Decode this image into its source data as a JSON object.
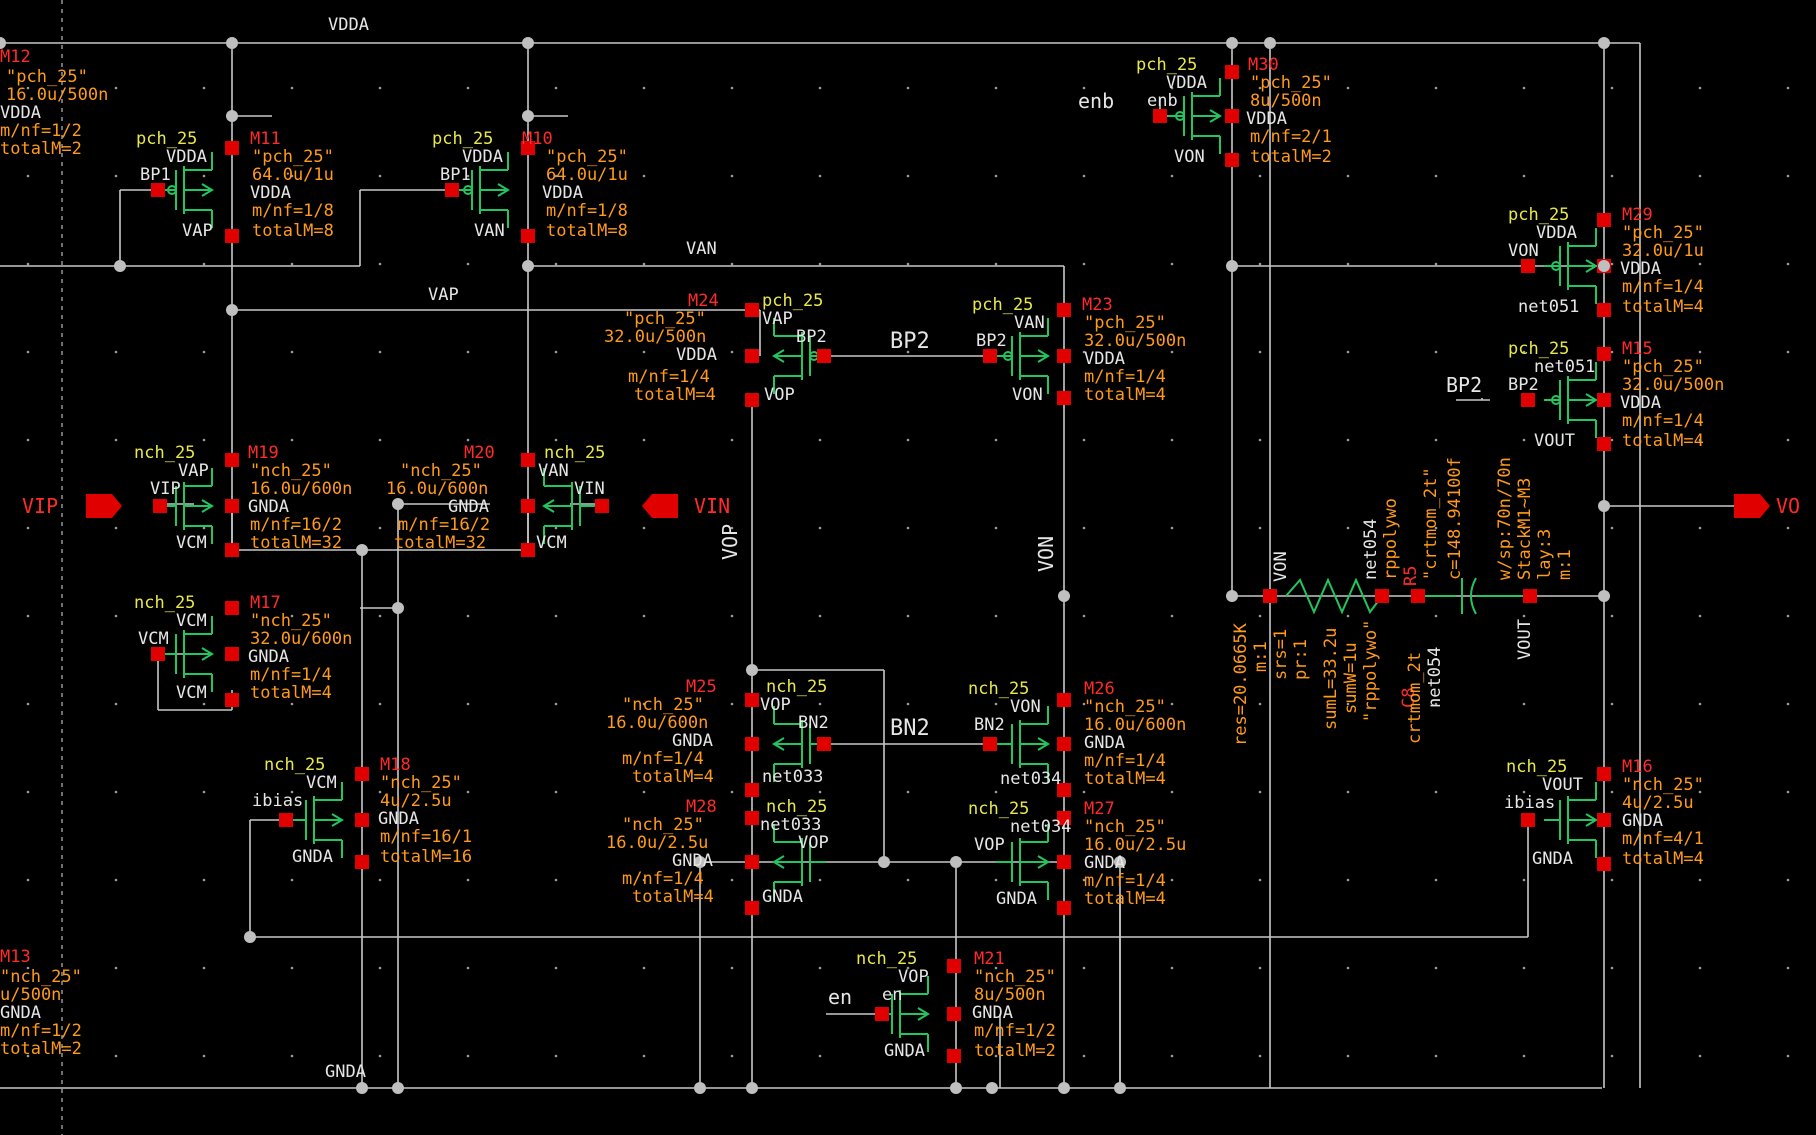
{
  "colors": {
    "background": "#000000",
    "wire": "#c8c8c8",
    "symbol": "#22c55e",
    "pin": "#e00000",
    "model": "#e8e84a",
    "instance": "#ff2a2a",
    "param": "#ff9a1a",
    "net_label": "#e6e6e6"
  },
  "nets": {
    "vdda": "VDDA",
    "gnda": "GNDA",
    "van": "VAN",
    "vap": "VAP",
    "bp2": "BP2",
    "bn2": "BN2",
    "vop": "VOP",
    "von": "VON",
    "vout": "VOUT",
    "enb": "enb",
    "en": "en"
  },
  "pins": {
    "vip": "VIP",
    "vin": "VIN",
    "vo": "VO"
  },
  "devices": {
    "M12": {
      "name": "M12",
      "model": "\"pch_25\"",
      "size": "16.0u/500n",
      "bulk": "VDDA",
      "mnf": "m/nf=1/2",
      "total": "totalM=2"
    },
    "M13": {
      "name": "M13",
      "model": "\"nch_25\"",
      "size": "u/500n",
      "bulk": "GNDA",
      "mnf": "m/nf=1/2",
      "total": "totalM=2"
    },
    "M11": {
      "type": "pch_25",
      "name": "M11",
      "model": "\"pch_25\"",
      "size": "64.0u/1u",
      "bulk": "VDDA",
      "gate": "BP1",
      "s": "VDDA",
      "d": "VAP",
      "mnf": "m/nf=1/8",
      "total": "totalM=8"
    },
    "M10": {
      "type": "pch_25",
      "name": "M10",
      "model": "\"pch_25\"",
      "size": "64.0u/1u",
      "bulk": "VDDA",
      "gate": "BP1",
      "s": "VDDA",
      "d": "VAN",
      "mnf": "m/nf=1/8",
      "total": "totalM=8"
    },
    "M30": {
      "type": "pch_25",
      "name": "M30",
      "model": "\"pch_25\"",
      "size": "8u/500n",
      "bulk": "VDDA",
      "gate": "enb",
      "s": "VDDA",
      "d": "VON",
      "mnf": "m/nf=2/1",
      "total": "totalM=2"
    },
    "M29": {
      "type": "pch_25",
      "name": "M29",
      "model": "\"pch_25\"",
      "size": "32.0u/1u",
      "bulk": "VDDA",
      "gate": "VON",
      "s": "VDDA",
      "d": "net051",
      "mnf": "m/nf=1/4",
      "total": "totalM=4"
    },
    "M15": {
      "type": "pch_25",
      "name": "M15",
      "model": "\"pch_25\"",
      "size": "32.0u/500n",
      "bulk": "net051",
      "gate": "BP2",
      "s": "VDDA",
      "d": "VOUT",
      "mnf": "m/nf=1/4",
      "total": "totalM=4"
    },
    "M24": {
      "type": "pch_25",
      "name": "M24",
      "model": "\"pch_25\"",
      "size": "32.0u/500n",
      "bulk": "VAP",
      "gate": "BP2",
      "s": "VDDA",
      "d": "VOP",
      "mnf": "m/nf=1/4",
      "total": "totalM=4"
    },
    "M23": {
      "type": "pch_25",
      "name": "M23",
      "model": "\"pch_25\"",
      "size": "32.0u/500n",
      "bulk": "VAN",
      "gate": "BP2",
      "s": "VDDA",
      "d": "VON",
      "mnf": "m/nf=1/4",
      "total": "totalM=4"
    },
    "M19": {
      "type": "nch_25",
      "name": "M19",
      "model": "\"nch_25\"",
      "size": "16.0u/600n",
      "bulk": "VAP",
      "gate": "VIP",
      "s": "GNDA",
      "d": "VCM",
      "mnf": "m/nf=16/2",
      "total": "totalM=32"
    },
    "M20": {
      "type": "nch_25",
      "name": "M20",
      "model": "\"nch_25\"",
      "size": "16.0u/600n",
      "bulk": "VAN",
      "gate": "VIN",
      "s": "GNDA",
      "d": "VCM",
      "mnf": "m/nf=16/2",
      "total": "totalM=32"
    },
    "M17": {
      "type": "nch_25",
      "name": "M17",
      "model": "\"nch_25\"",
      "size": "32.0u/600n",
      "bulk": "VCM",
      "gate": "VCM",
      "s": "GNDA",
      "d": "VCM",
      "mnf": "m/nf=1/4",
      "total": "totalM=4"
    },
    "M18": {
      "type": "nch_25",
      "name": "M18",
      "model": "\"nch_25\"",
      "size": "4u/2.5u",
      "bulk": "VCM",
      "gate": "ibias",
      "s": "GNDA",
      "d": "GNDA",
      "mnf": "m/nf=16/1",
      "total": "totalM=16"
    },
    "M25": {
      "type": "nch_25",
      "name": "M25",
      "model": "\"nch_25\"",
      "size": "16.0u/600n",
      "bulk": "VOP",
      "gate": "BN2",
      "s": "GNDA",
      "d": "net033",
      "mnf": "m/nf=1/4",
      "total": "totalM=4"
    },
    "M26": {
      "type": "nch_25",
      "name": "M26",
      "model": "\"nch_25\"",
      "size": "16.0u/600n",
      "bulk": "VON",
      "gate": "BN2",
      "s": "GNDA",
      "d": "net034",
      "mnf": "m/nf=1/4",
      "total": "totalM=4"
    },
    "M28": {
      "type": "nch_25",
      "name": "M28",
      "model": "\"nch_25\"",
      "size": "16.0u/2.5u",
      "bulk": "net033",
      "gate": "VOP",
      "s": "GNDA",
      "d": "GNDA",
      "mnf": "m/nf=1/4",
      "total": "totalM=4"
    },
    "M27": {
      "type": "nch_25",
      "name": "M27",
      "model": "\"nch_25\"",
      "size": "16.0u/2.5u",
      "bulk": "net034",
      "gate": "VOP",
      "s": "GNDA",
      "d": "GNDA",
      "mnf": "m/nf=1/4",
      "total": "totalM=4"
    },
    "M21": {
      "type": "nch_25",
      "name": "M21",
      "model": "\"nch_25\"",
      "size": "8u/500n",
      "bulk": "VOP",
      "gate": "en",
      "s": "GNDA",
      "d": "GNDA",
      "mnf": "m/nf=1/2",
      "total": "totalM=2"
    },
    "M16": {
      "type": "nch_25",
      "name": "M16",
      "model": "\"nch_25\"",
      "size": "4u/2.5u",
      "bulk": "VOUT",
      "gate": "ibias",
      "s": "GNDA",
      "d": "GNDA",
      "mnf": "m/nf=4/1",
      "total": "totalM=4"
    }
  },
  "resistor": {
    "name": "R5",
    "net_a": "VON",
    "net_b": "net054",
    "model": "rppolywo",
    "params": [
      "res=20.0665K",
      "m:1",
      "srs=1",
      "pr:1",
      "sumL=33.2u",
      "sumW=1u",
      "\"rppolywo\""
    ]
  },
  "capacitor": {
    "name": "C8",
    "model": "\"crtmom_2t\"",
    "value": "c=148.94100f",
    "params": [
      "w/sp:70n/70n",
      "StackM1~M3",
      "lay:3",
      "m:1"
    ],
    "net_a": "net054",
    "net_b": "VOUT",
    "sub": "crtmom_2t"
  }
}
